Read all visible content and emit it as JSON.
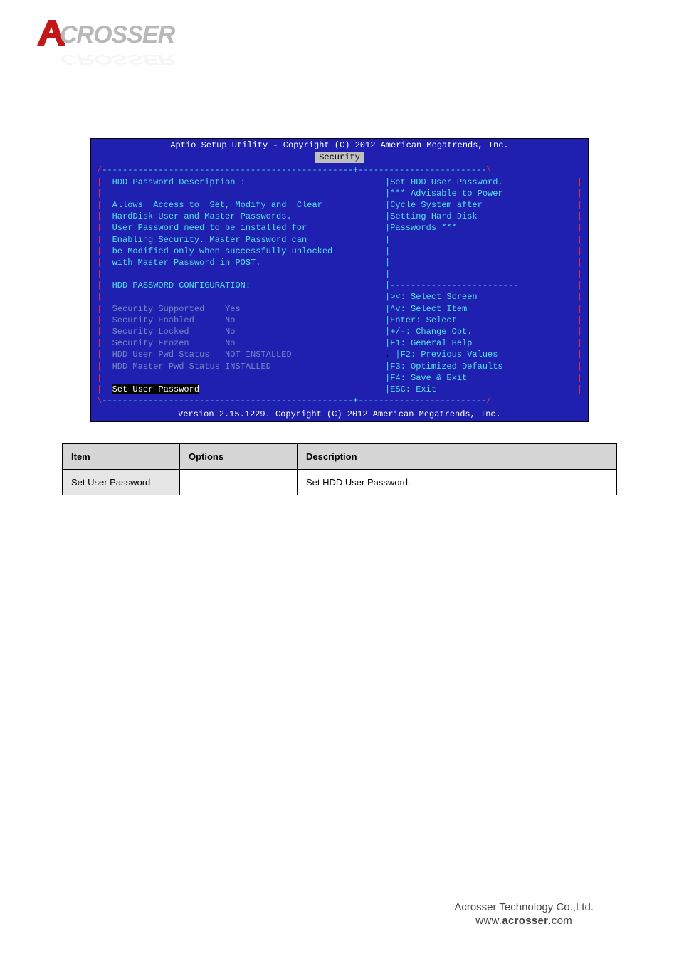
{
  "logo": {
    "text": "CROSSER",
    "brand": "ACROSSER"
  },
  "bios": {
    "title": "Aptio Setup Utility - Copyright (C) 2012 American Megatrends, Inc.",
    "tab": "Security",
    "desc_head": "HDD Password Description :",
    "desc": [
      "Allows  Access to  Set, Modify and  Clear",
      "HardDisk User and Master Passwords.",
      "User Password need to be installed for",
      "Enabling Security. Master Password can",
      "be Modified only when successfully unlocked",
      "with Master Password in POST."
    ],
    "cfg_head": "HDD PASSWORD CONFIGURATION:",
    "cfg": [
      {
        "k": "Security Supported",
        "v": "Yes"
      },
      {
        "k": "Security Enabled",
        "v": "No"
      },
      {
        "k": "Security Locked",
        "v": "No"
      },
      {
        "k": "Security Frozen",
        "v": "No"
      },
      {
        "k": "HDD User Pwd Status",
        "v": "NOT INSTALLED"
      },
      {
        "k": "HDD Master Pwd Status",
        "v": "INSTALLED"
      }
    ],
    "selected": "Set User Password",
    "help": [
      "Set HDD User Password.",
      "*** Advisable to Power",
      "Cycle System after",
      "Setting Hard Disk",
      "Passwords ***"
    ],
    "keys": [
      "><: Select Screen",
      "^v: Select Item",
      "Enter: Select",
      "+/-: Change Opt.",
      "F1: General Help",
      "F2: Previous Values",
      "F3: Optimized Defaults",
      "F4: Save & Exit",
      "ESC: Exit"
    ],
    "footer": "Version 2.15.1229. Copyright (C) 2012 American Megatrends, Inc."
  },
  "table": {
    "headers": [
      "Item",
      "Options",
      "Description"
    ],
    "row": {
      "item": "Set User Password",
      "opt": "---",
      "desc": "Set HDD User Password."
    }
  },
  "footer": {
    "company": "Acrosser Technology Co.,Ltd.",
    "url_pre": "www.",
    "url_bold": "acrosser",
    "url_post": ".com"
  }
}
